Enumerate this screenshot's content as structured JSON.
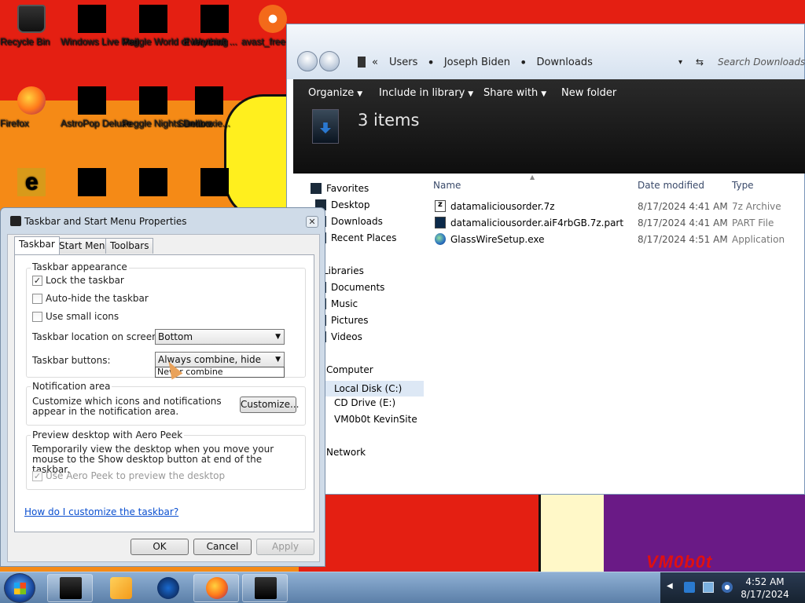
{
  "desktop": {
    "icons": [
      {
        "label": "Recycle Bin",
        "icon": "recycle-bin-icon"
      },
      {
        "label": "Windows Live Mail",
        "icon": "windows-live-mail-icon"
      },
      {
        "label": "Peggle World of Warcraft ...",
        "icon": "peggle-wow-icon"
      },
      {
        "label": "Everything",
        "icon": "everything-search-icon"
      },
      {
        "label": "avast_free",
        "icon": "avast-icon"
      },
      {
        "label": "Firefox",
        "icon": "firefox-icon"
      },
      {
        "label": "AstroPop Deluxe",
        "icon": "astropop-icon"
      },
      {
        "label": "Peggle Nights Deluxe",
        "icon": "peggle-nights-icon"
      },
      {
        "label": "Sandboxie...",
        "icon": "sandboxie-icon"
      }
    ],
    "wallpaper_text": "VM0b0t"
  },
  "explorer": {
    "breadcrumb": [
      "Users",
      "Joseph Biden",
      "Downloads"
    ],
    "breadcrumb_root": "«",
    "search_placeholder": "Search Downloads",
    "toolbar": {
      "organize": "Organize",
      "include_in_library": "Include in library",
      "share_with": "Share with",
      "new_folder": "New folder"
    },
    "item_count": "3 items",
    "nav": {
      "favorites": "Favorites",
      "desktop": "Desktop",
      "downloads": "Downloads",
      "recent_places": "Recent Places",
      "libraries": "Libraries",
      "documents": "Documents",
      "music": "Music",
      "pictures": "Pictures",
      "videos": "Videos",
      "computer": "Computer",
      "local_disk": "Local Disk (C:)",
      "cd_drive": "CD Drive (E:)",
      "vm_site": "VM0b0t KevinSite",
      "network": "Network"
    },
    "columns": {
      "name": "Name",
      "date_modified": "Date modified",
      "type": "Type"
    },
    "files": [
      {
        "name": "datamaliciousorder.7z",
        "date": "8/17/2024 4:41 AM",
        "type": "7z Archive"
      },
      {
        "name": "datamaliciousorder.aiF4rbGB.7z.part",
        "date": "8/17/2024 4:41 AM",
        "type": "PART File"
      },
      {
        "name": "GlassWireSetup.exe",
        "date": "8/17/2024 4:51 AM",
        "type": "Application"
      }
    ]
  },
  "dialog": {
    "title": "Taskbar and Start Menu Properties",
    "close": "✕",
    "tabs": {
      "taskbar": "Taskbar",
      "start_menu": "Start Menu",
      "toolbars": "Toolbars"
    },
    "appearance": {
      "title": "Taskbar appearance",
      "lock": "Lock the taskbar",
      "autohide": "Auto-hide the taskbar",
      "small_icons": "Use small icons",
      "location_label": "Taskbar location on screen:",
      "location_value": "Bottom",
      "buttons_label": "Taskbar buttons:",
      "buttons_value": "Always combine, hide labels",
      "buttons_option_visible": "Never combine"
    },
    "notification": {
      "title": "Notification area",
      "text": "Customize which icons and notifications appear in the notification area.",
      "customize_button": "Customize..."
    },
    "aero_peek": {
      "title": "Preview desktop with Aero Peek",
      "text": "Temporarily view the desktop when you move your mouse to the Show desktop button at end of the taskbar.",
      "checkbox": "Use Aero Peek to preview the desktop"
    },
    "help_link": "How do I customize the taskbar?",
    "buttons": {
      "ok": "OK",
      "cancel": "Cancel",
      "apply": "Apply"
    },
    "checked": "✓"
  },
  "taskbar": {
    "clock_time": "4:52 AM",
    "clock_date": "8/17/2024"
  }
}
